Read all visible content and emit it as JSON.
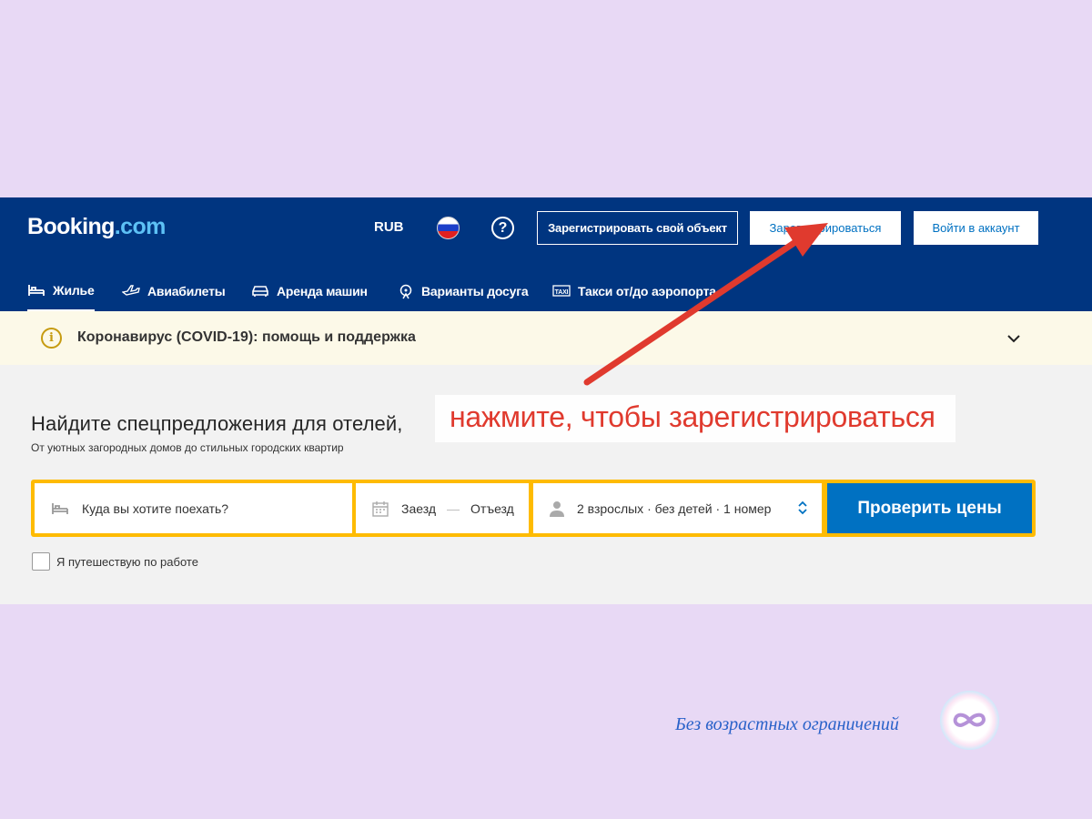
{
  "header": {
    "logo_main": "Booking",
    "logo_suffix": ".com",
    "currency": "RUB",
    "help": "?",
    "list_property": "Зарегистрировать свой объект",
    "register": "Зарегистрироваться",
    "sign_in": "Войти в аккаунт"
  },
  "nav": {
    "tabs": [
      {
        "label": "Жилье",
        "icon": "bed-icon",
        "active": true
      },
      {
        "label": "Авиабилеты",
        "icon": "plane-icon",
        "active": false
      },
      {
        "label": "Аренда машин",
        "icon": "car-icon",
        "active": false
      },
      {
        "label": "Варианты досуга",
        "icon": "attractions-icon",
        "active": false
      },
      {
        "label": "Такси от/до аэропорта",
        "icon": "taxi-icon",
        "active": false
      }
    ]
  },
  "banner": {
    "icon": "info-icon",
    "text": "Коронавирус (COVID-19): помощь и поддержка"
  },
  "search": {
    "title": "Найдите спецпредложения для отелей,",
    "subtitle": "От уютных загородных домов до стильных городских квартир",
    "destination_placeholder": "Куда вы хотите поехать?",
    "checkin": "Заезд",
    "dash": "—",
    "checkout": "Отъезд",
    "guests": "2 взрослых · без детей · 1 номер",
    "submit": "Проверить цены",
    "business_travel": "Я путешествую по работе"
  },
  "annotation": {
    "text": "нажмите, чтобы зарегистрироваться",
    "color": "#e03a2e"
  },
  "watermark": {
    "text": "Без возрастных ограничений"
  },
  "colors": {
    "brand_blue": "#003580",
    "action_blue": "#0071c2",
    "search_yellow": "#febb02",
    "page_bg": "#e8d9f5"
  }
}
